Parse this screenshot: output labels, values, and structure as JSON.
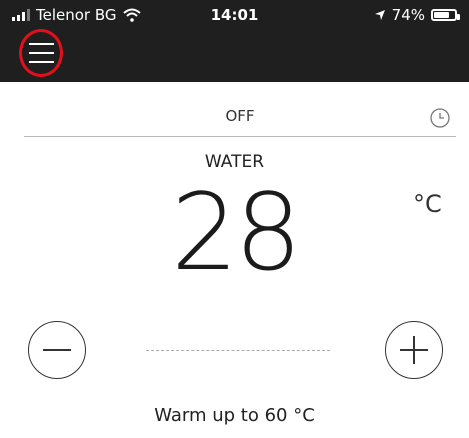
{
  "status_bar": {
    "carrier": "Telenor BG",
    "time": "14:01",
    "battery": "74%",
    "battery_level": 0.74,
    "icons": [
      "signal-icon",
      "wifi-icon",
      "location-arrow-icon",
      "battery-icon"
    ]
  },
  "header": {
    "menu_icon": "hamburger-menu-icon",
    "highlight_color": "#e3101b"
  },
  "timer": {
    "state": "OFF",
    "icon": "clock-icon"
  },
  "mode": "WATER",
  "temperature": {
    "value": "28",
    "unit": "°C"
  },
  "controls": {
    "minus_icon": "minus-icon",
    "plus_icon": "plus-icon"
  },
  "status_text": "Warm up to 60 °C",
  "colors": {
    "topbar": "#1f1f1f",
    "background": "#ffffff",
    "text": "#222222"
  }
}
